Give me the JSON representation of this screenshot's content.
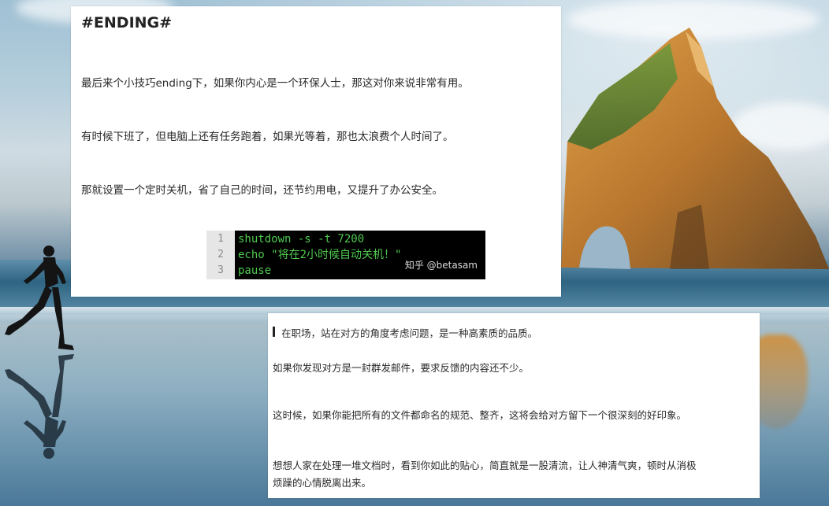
{
  "card_top": {
    "heading": "#ENDING#",
    "paragraphs": [
      "最后来个小技巧ending下，如果你内心是一个环保人士，那这对你来说非常有用。",
      "有时候下班了，但电脑上还有任务跑着，如果光等着，那也太浪费个人时间了。",
      "那就设置一个定时关机，省了自己的时间，还节约用电，又提升了办公安全。"
    ],
    "code": {
      "lines": [
        {
          "num": "1",
          "text": "shutdown -s -t 7200"
        },
        {
          "num": "2",
          "text": "echo \"将在2小时候自动关机！\""
        },
        {
          "num": "3",
          "text": "pause"
        }
      ],
      "watermark": "知乎 @betasam"
    }
  },
  "card_bottom": {
    "paragraphs": [
      "在职场，站在对方的角度考虑问题，是一种高素质的品质。",
      "如果你发现对方是一封群发邮件，要求反馈的内容还不少。",
      "这时候，如果你能把所有的文件都命名的规范、整齐，这将会给对方留下一个很深刻的好印象。",
      "想想人家在处理一堆文档时，看到你如此的贴心，简直就是一股清流，让人神清气爽，顿时从消极",
      "烦躁的心情脱离出来。"
    ]
  },
  "colors": {
    "code_text": "#4ec94e",
    "code_bg": "#000000",
    "rock": "#c98a3a"
  }
}
